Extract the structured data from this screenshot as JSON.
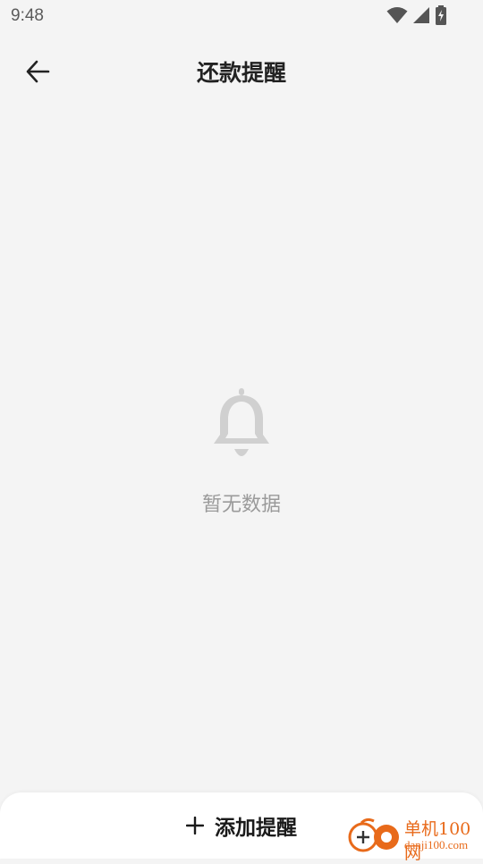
{
  "status_bar": {
    "time": "9:48",
    "icons": [
      "wifi-icon",
      "cell-signal-icon",
      "battery-charging-icon"
    ]
  },
  "header": {
    "title": "还款提醒",
    "back_icon": "arrow-left-icon"
  },
  "empty_state": {
    "icon": "bell-icon",
    "message": "暂无数据"
  },
  "footer": {
    "add_button_icon": "plus-icon",
    "add_button_label": "添加提醒"
  },
  "watermark": {
    "name_cn": "单机100网",
    "domain": "danji100.com"
  },
  "colors": {
    "background": "#f4f4f4",
    "icon_gray": "#d0d0d0",
    "watermark_orange": "#e86a1a"
  }
}
